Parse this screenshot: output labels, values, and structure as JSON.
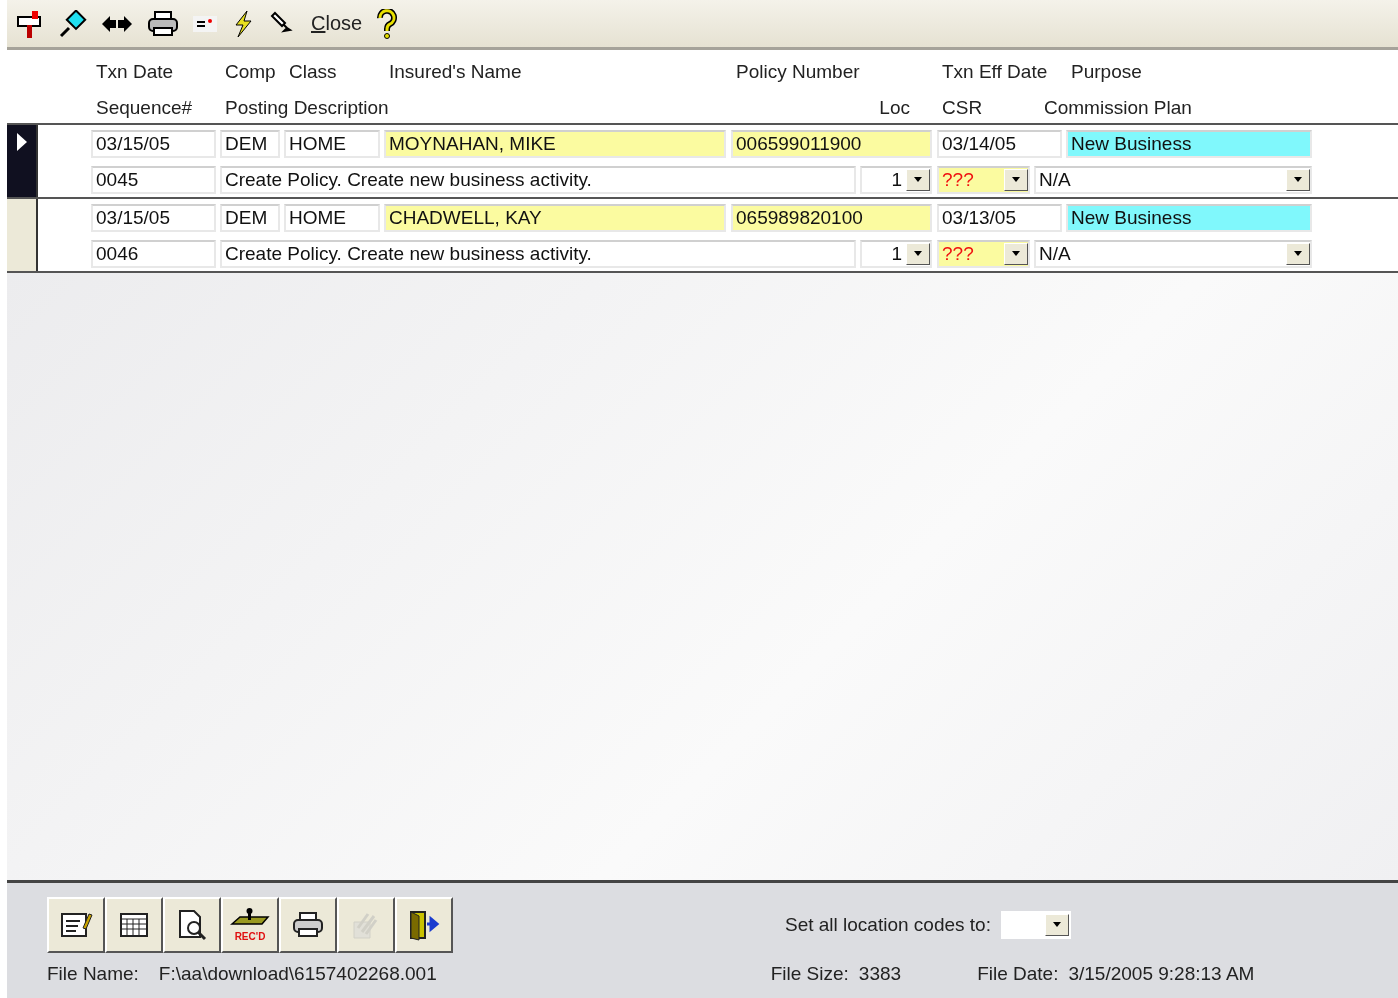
{
  "toolbar": {
    "close": "Close"
  },
  "header": {
    "txn_date": "Txn Date",
    "comp": "Comp",
    "class": "Class",
    "insured_name": "Insured's Name",
    "policy_number": "Policy Number",
    "txn_eff_date": "Txn Eff Date",
    "purpose": "Purpose",
    "sequence": "Sequence#",
    "posting_description": "Posting Description",
    "loc": "Loc",
    "csr": "CSR",
    "commission_plan": "Commission Plan"
  },
  "rows": [
    {
      "selected": true,
      "txn_date": "03/15/05",
      "comp": "DEM",
      "class": "HOME",
      "insured_name": "MOYNAHAN, MIKE",
      "policy_number": "006599011900",
      "txn_eff_date": "03/14/05",
      "purpose": "New Business",
      "sequence": "0045",
      "posting_description": "Create Policy. Create new business activity.",
      "loc": "1",
      "csr": "???",
      "commission_plan": "N/A"
    },
    {
      "selected": false,
      "txn_date": "03/15/05",
      "comp": "DEM",
      "class": "HOME",
      "insured_name": "CHADWELL, KAY",
      "policy_number": "065989820100",
      "txn_eff_date": "03/13/05",
      "purpose": "New Business",
      "sequence": "0046",
      "posting_description": "Create Policy. Create new business activity.",
      "loc": "1",
      "csr": "???",
      "commission_plan": "N/A"
    }
  ],
  "bottom_buttons": [
    {
      "kind": "edit",
      "disabled": false
    },
    {
      "kind": "grid",
      "disabled": false
    },
    {
      "kind": "preview",
      "disabled": false
    },
    {
      "kind": "stamp",
      "disabled": false,
      "label": "REC'D"
    },
    {
      "kind": "print",
      "disabled": false
    },
    {
      "kind": "post",
      "disabled": true
    },
    {
      "kind": "exit",
      "disabled": false
    }
  ],
  "location_codes": {
    "label": "Set all location codes to:"
  },
  "status": {
    "file_name_label": "File Name:",
    "file_name": "F:\\aa\\download\\6157402268.001",
    "file_size_label": "File Size:",
    "file_size": "3383",
    "file_date_label": "File Date:",
    "file_date": "3/15/2005 9:28:13 AM"
  }
}
